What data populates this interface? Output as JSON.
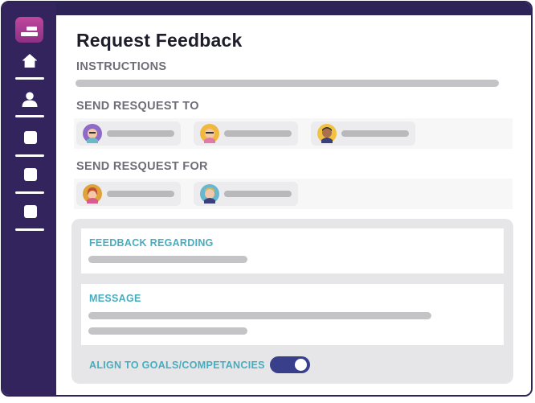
{
  "app": {
    "title": "Request Feedback",
    "colors": {
      "sidebar": "#33245e",
      "accent_label": "#46adbf",
      "toggle_on": "#3a3f8c",
      "logo": "#b03d95"
    }
  },
  "sidebar": {
    "items": [
      {
        "icon": "logo-icon"
      },
      {
        "icon": "home-icon"
      },
      {
        "icon": "user-icon"
      },
      {
        "icon": "square-icon"
      },
      {
        "icon": "square-icon"
      },
      {
        "icon": "square-icon"
      }
    ]
  },
  "form": {
    "instructions_label": "INSTRUCTIONS",
    "send_to_label": "SEND RESQUEST TO",
    "send_to_people": [
      {
        "avatar": "avatar-woman-purple-hair-icon"
      },
      {
        "avatar": "avatar-woman-blonde-glasses-icon"
      },
      {
        "avatar": "avatar-man-dark-hair-icon"
      }
    ],
    "send_for_label": "SEND RESQUEST FOR",
    "send_for_people": [
      {
        "avatar": "avatar-woman-red-hair-icon"
      },
      {
        "avatar": "avatar-man-blonde-hair-icon"
      }
    ],
    "feedback_regarding_label": "FEEDBACK REGARDING",
    "message_label": "MESSAGE",
    "align_label": "ALIGN TO GOALS/COMPETANCIES",
    "align_toggle_on": true
  }
}
